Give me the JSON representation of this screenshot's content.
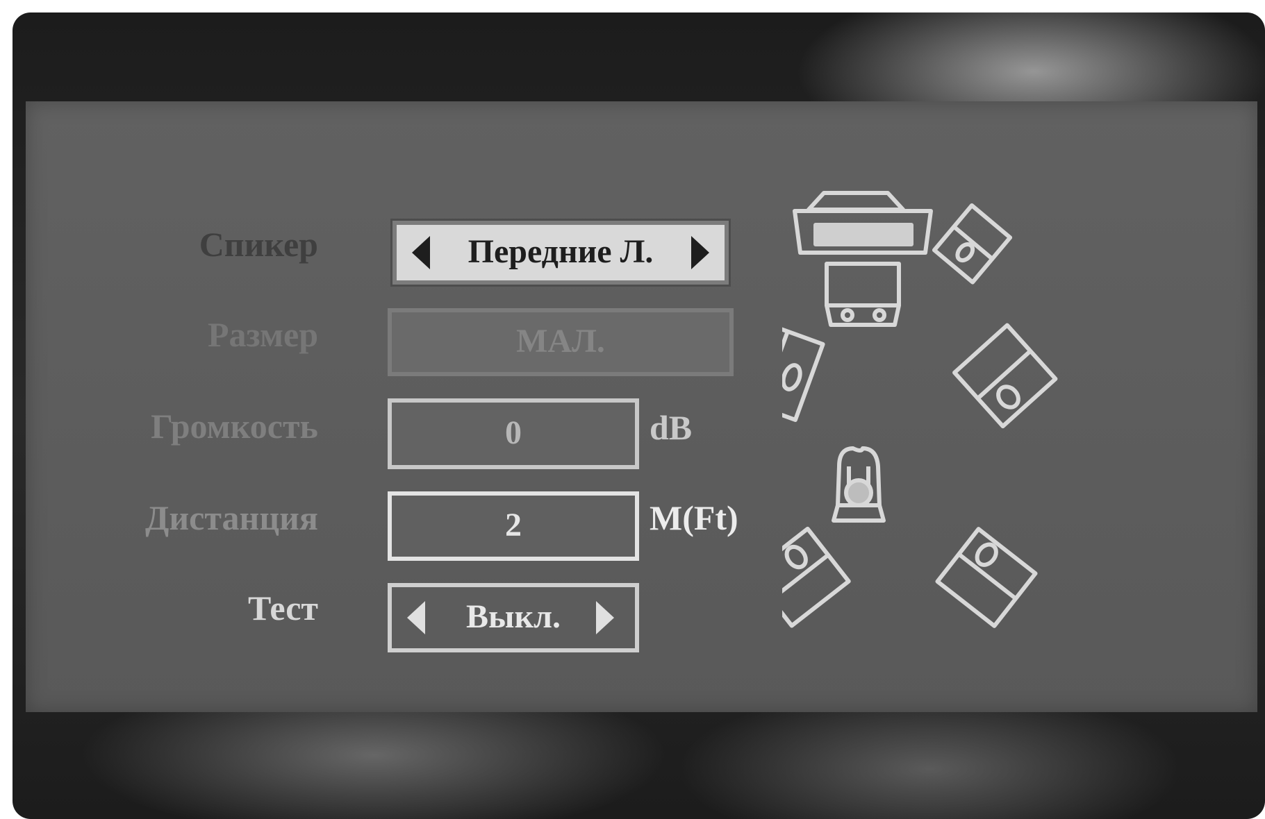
{
  "speaker_setup": {
    "rows": [
      {
        "label": "Спикер",
        "value": "Передние Л."
      },
      {
        "label": "Размер",
        "value": "МАЛ."
      },
      {
        "label": "Громкость",
        "value": "0",
        "unit": "dB"
      },
      {
        "label": "Дистанция",
        "value": "2",
        "unit": "M(Ft)"
      },
      {
        "label": "Тест",
        "value": "Выкл."
      }
    ],
    "selected_row": "Спикер"
  },
  "colors": {
    "panel": "#5e5e5e",
    "frame": "#222222",
    "highlight_field": "#d9d9d9",
    "speaker_outline": "#d8d8d8"
  }
}
